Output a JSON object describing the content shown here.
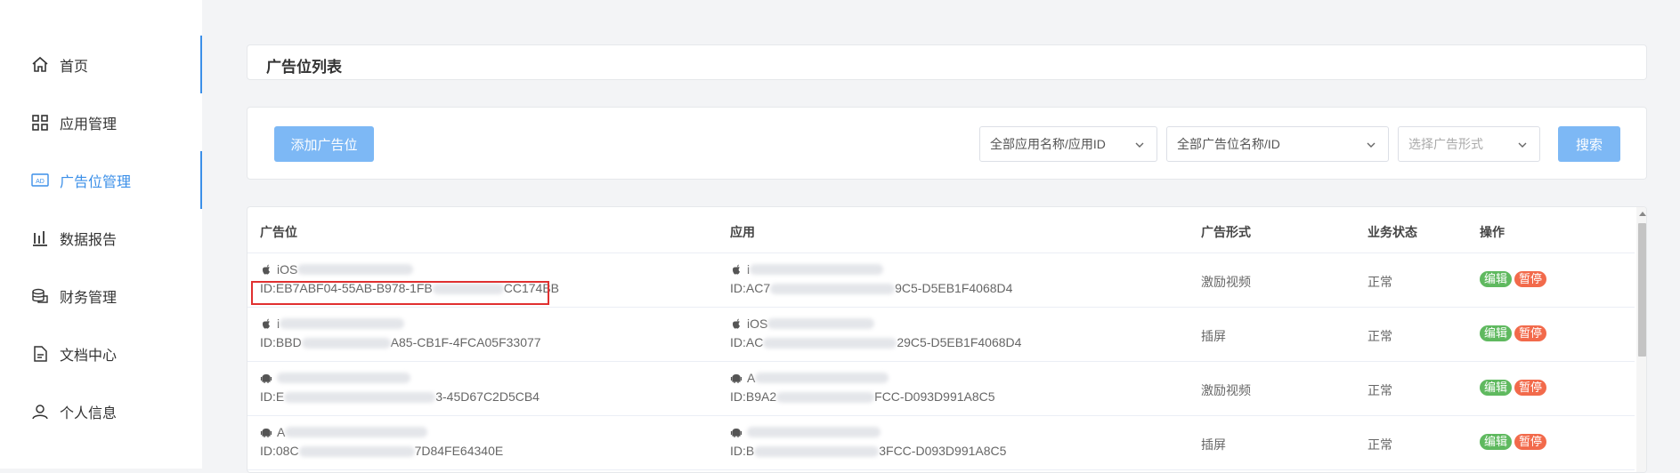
{
  "sidebar": {
    "items": [
      {
        "label": "首页",
        "icon": "home-icon",
        "active": false
      },
      {
        "label": "应用管理",
        "icon": "apps-grid-icon",
        "active": false
      },
      {
        "label": "广告位管理",
        "icon": "ad-icon",
        "active": true
      },
      {
        "label": "数据报告",
        "icon": "bar-chart-icon",
        "active": false
      },
      {
        "label": "财务管理",
        "icon": "coins-icon",
        "active": false
      },
      {
        "label": "文档中心",
        "icon": "document-icon",
        "active": false
      },
      {
        "label": "个人信息",
        "icon": "user-icon",
        "active": false
      }
    ]
  },
  "page": {
    "title": "广告位列表"
  },
  "filters": {
    "add_label": "添加广告位",
    "app_select": "全部应用名称/应用ID",
    "slot_select": "全部广告位名称/ID",
    "format_placeholder": "选择广告形式",
    "search_label": "搜索"
  },
  "table": {
    "headers": [
      "广告位",
      "应用",
      "广告形式",
      "业务状态",
      "操作"
    ],
    "rows": [
      {
        "platform": "apple-icon",
        "slot_name": "iOS",
        "slot_id": "ID:EB7ABF04-55AB-B978-1FB",
        "slot_id_tail": "CC174BB",
        "app_platform": "apple-icon",
        "app_name": "i",
        "app_id": "ID:AC7",
        "app_id_tail": "9C5-D5EB1F4068D4",
        "format": "激励视频",
        "status": "正常"
      },
      {
        "platform": "apple-icon",
        "slot_name": "i",
        "slot_id": "ID:BBD",
        "slot_id_tail": "A85-CB1F-4FCA05F33077",
        "app_platform": "apple-icon",
        "app_name": "iOS",
        "app_id": "ID:AC",
        "app_id_tail": "29C5-D5EB1F4068D4",
        "format": "插屏",
        "status": "正常"
      },
      {
        "platform": "android-icon",
        "slot_name": "",
        "slot_id": "ID:E",
        "slot_id_tail": "3-45D67C2D5CB4",
        "app_platform": "android-icon",
        "app_name": "A",
        "app_id": "ID:B9A2",
        "app_id_tail": "FCC-D093D991A8C5",
        "format": "激励视频",
        "status": "正常"
      },
      {
        "platform": "android-icon",
        "slot_name": "A",
        "slot_id": "ID:08C",
        "slot_id_tail": "7D84FE64340E",
        "app_platform": "android-icon",
        "app_name": "",
        "app_id": "ID:B",
        "app_id_tail": "3FCC-D093D991A8C5",
        "format": "插屏",
        "status": "正常"
      }
    ],
    "edit_label": "编辑",
    "pause_label": "暂停"
  },
  "colors": {
    "accent": "#3b8fe8",
    "button": "#7db8f5",
    "edit": "#5fb95f",
    "pause": "#f26a4b",
    "highlight": "#e03030"
  }
}
